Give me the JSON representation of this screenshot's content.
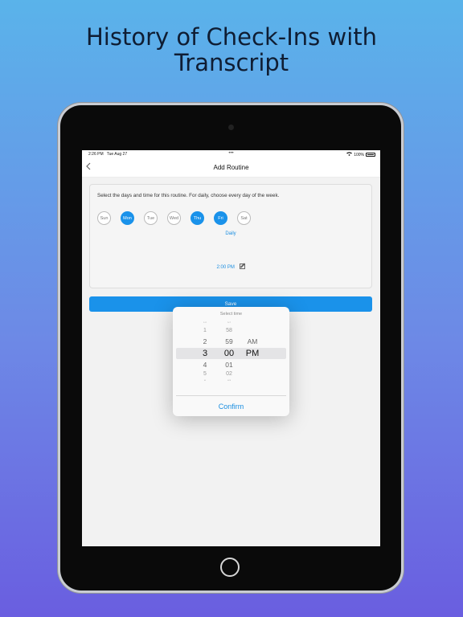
{
  "headline": {
    "line1": "History of Check-Ins with",
    "line2": "Transcript"
  },
  "status": {
    "time": "2:26 PM",
    "date": "Tue Aug 27",
    "dots": "•••",
    "battery": "100%"
  },
  "nav": {
    "back_icon": "chevron-left-icon",
    "title": "Add Routine"
  },
  "routine": {
    "instruction": "Select the days and time for this routine.  For daily, choose every day of the week.",
    "days": [
      {
        "label": "Sun",
        "selected": false
      },
      {
        "label": "Mon",
        "selected": true
      },
      {
        "label": "Tue",
        "selected": false
      },
      {
        "label": "Wed",
        "selected": false
      },
      {
        "label": "Thu",
        "selected": true
      },
      {
        "label": "Fri",
        "selected": true
      },
      {
        "label": "Sat",
        "selected": false
      }
    ],
    "frequency": "Daily",
    "time": "2:00 PM",
    "save_label": "Save"
  },
  "picker": {
    "title": "Select time",
    "hours": [
      "12",
      "1",
      "2",
      "3",
      "4",
      "5",
      "6"
    ],
    "minutes": [
      "57",
      "58",
      "59",
      "00",
      "01",
      "02",
      "03"
    ],
    "periods": [
      "AM",
      "PM"
    ],
    "selected": {
      "hour": "3",
      "minute": "00",
      "period": "PM"
    },
    "confirm_label": "Confirm"
  },
  "colors": {
    "accent": "#1a92ea"
  }
}
